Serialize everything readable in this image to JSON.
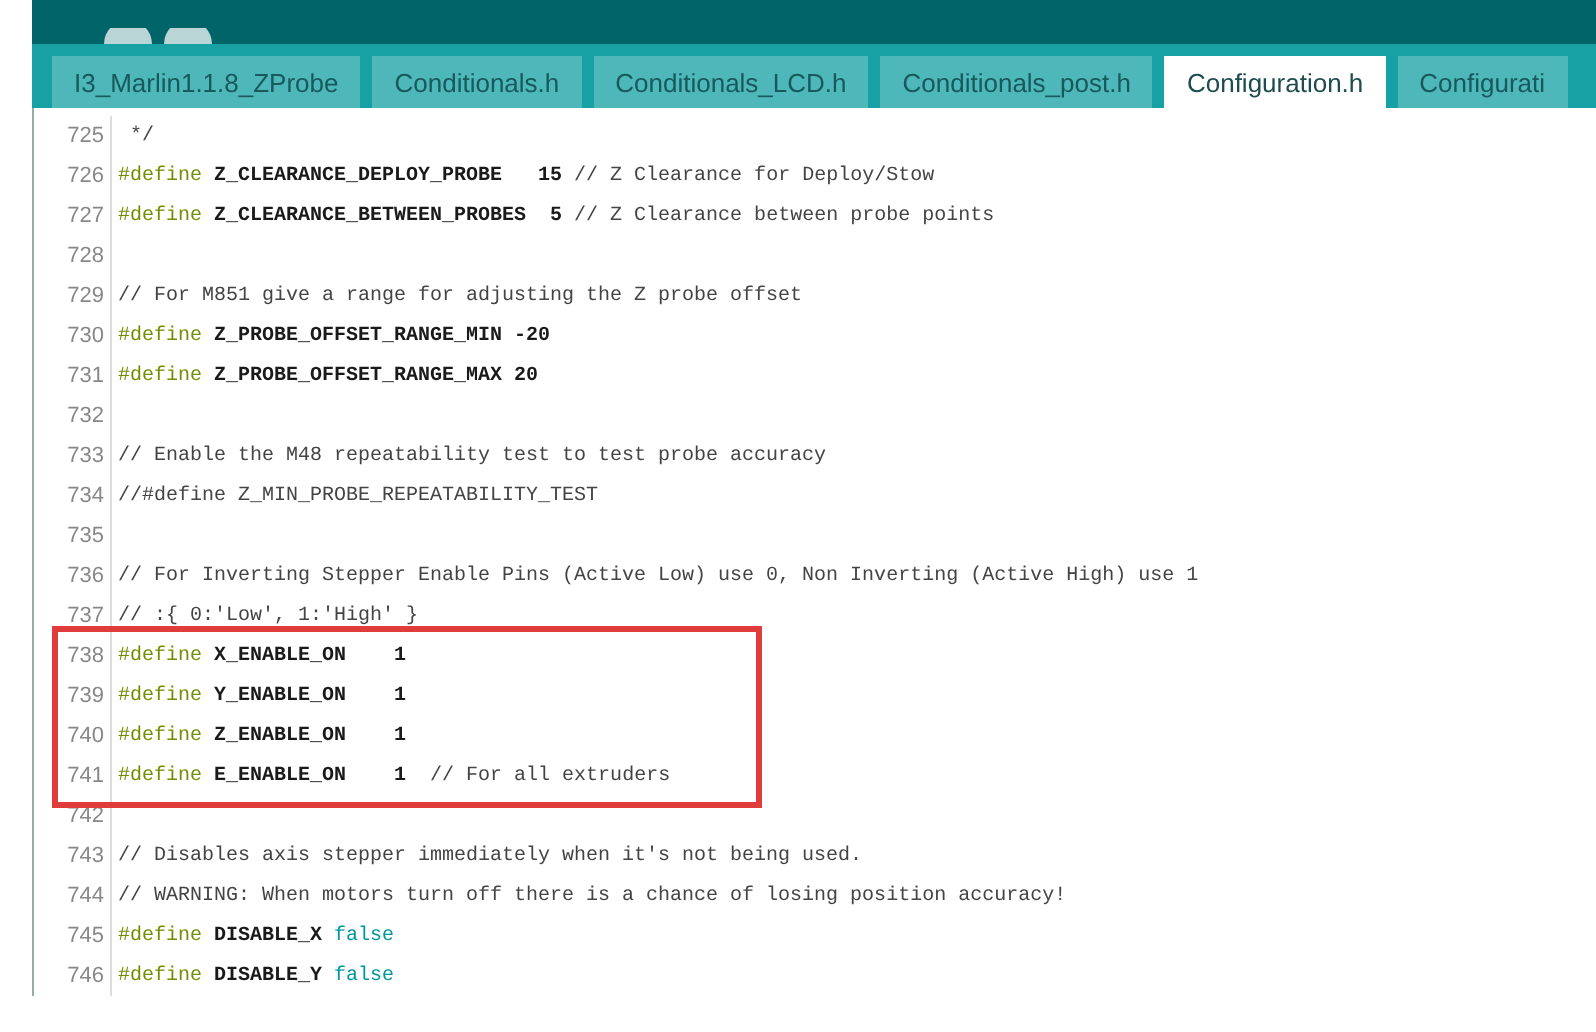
{
  "tabs": [
    {
      "label": "I3_Marlin1.1.8_ZProbe",
      "selected": false
    },
    {
      "label": "Conditionals.h",
      "selected": false
    },
    {
      "label": "Conditionals_LCD.h",
      "selected": false
    },
    {
      "label": "Conditionals_post.h",
      "selected": false
    },
    {
      "label": "Configuration.h",
      "selected": true
    },
    {
      "label": "Configurati",
      "selected": false
    }
  ],
  "lines_before": [
    {
      "number": "725",
      "segments": [
        {
          "kind": "comment",
          "text": " */"
        }
      ]
    },
    {
      "number": "726",
      "segments": [
        {
          "kind": "keyword",
          "text": "#define"
        },
        {
          "kind": "plain",
          "text": " Z_CLEARANCE_DEPLOY_PROBE   15 "
        },
        {
          "kind": "comment",
          "text": "// Z Clearance for Deploy/Stow"
        }
      ]
    },
    {
      "number": "727",
      "segments": [
        {
          "kind": "keyword",
          "text": "#define"
        },
        {
          "kind": "plain",
          "text": " Z_CLEARANCE_BETWEEN_PROBES  5 "
        },
        {
          "kind": "comment",
          "text": "// Z Clearance between probe points"
        }
      ]
    },
    {
      "number": "728"
    },
    {
      "number": "729",
      "segments": [
        {
          "kind": "comment",
          "text": "// For M851 give a range for adjusting the Z probe offset"
        }
      ]
    },
    {
      "number": "730",
      "segments": [
        {
          "kind": "keyword",
          "text": "#define"
        },
        {
          "kind": "plain",
          "text": " Z_PROBE_OFFSET_RANGE_MIN -20"
        }
      ]
    },
    {
      "number": "731",
      "segments": [
        {
          "kind": "keyword",
          "text": "#define"
        },
        {
          "kind": "plain",
          "text": " Z_PROBE_OFFSET_RANGE_MAX 20"
        }
      ]
    },
    {
      "number": "732"
    },
    {
      "number": "733",
      "segments": [
        {
          "kind": "comment",
          "text": "// Enable the M48 repeatability test to test probe accuracy"
        }
      ]
    },
    {
      "number": "734",
      "segments": [
        {
          "kind": "comment",
          "text": "//#define Z_MIN_PROBE_REPEATABILITY_TEST"
        }
      ]
    },
    {
      "number": "735"
    },
    {
      "number": "736",
      "segments": [
        {
          "kind": "comment",
          "text": "// For Inverting Stepper Enable Pins (Active Low) use 0, Non Inverting (Active High) use 1"
        }
      ]
    },
    {
      "number": "737",
      "segments": [
        {
          "kind": "comment",
          "text": "// :{ 0:'Low', 1:'High' }"
        }
      ]
    }
  ],
  "highlighted_lines": [
    {
      "number": "738",
      "segments": [
        {
          "kind": "keyword",
          "text": "#define"
        },
        {
          "kind": "plain",
          "text": " X_ENABLE_ON    1"
        }
      ]
    },
    {
      "number": "739",
      "segments": [
        {
          "kind": "keyword",
          "text": "#define"
        },
        {
          "kind": "plain",
          "text": " Y_ENABLE_ON    1"
        }
      ]
    },
    {
      "number": "740",
      "segments": [
        {
          "kind": "keyword",
          "text": "#define"
        },
        {
          "kind": "plain",
          "text": " Z_ENABLE_ON    1"
        }
      ]
    },
    {
      "number": "741",
      "segments": [
        {
          "kind": "keyword",
          "text": "#define"
        },
        {
          "kind": "plain",
          "text": " E_ENABLE_ON    1  "
        },
        {
          "kind": "comment",
          "text": "// For all extruders"
        }
      ]
    }
  ],
  "lines_after": [
    {
      "number": "742"
    },
    {
      "number": "743",
      "segments": [
        {
          "kind": "comment",
          "text": "// Disables axis stepper immediately when it's not being used."
        }
      ]
    },
    {
      "number": "744",
      "segments": [
        {
          "kind": "comment",
          "text": "// WARNING: When motors turn off there is a chance of losing position accuracy!"
        }
      ]
    },
    {
      "number": "745",
      "segments": [
        {
          "kind": "keyword",
          "text": "#define"
        },
        {
          "kind": "plain",
          "text": " DISABLE_X "
        },
        {
          "kind": "constant",
          "text": "false"
        }
      ]
    },
    {
      "number": "746",
      "segments": [
        {
          "kind": "keyword",
          "text": "#define"
        },
        {
          "kind": "plain",
          "text": " DISABLE_Y "
        },
        {
          "kind": "constant",
          "text": "false"
        }
      ]
    }
  ]
}
